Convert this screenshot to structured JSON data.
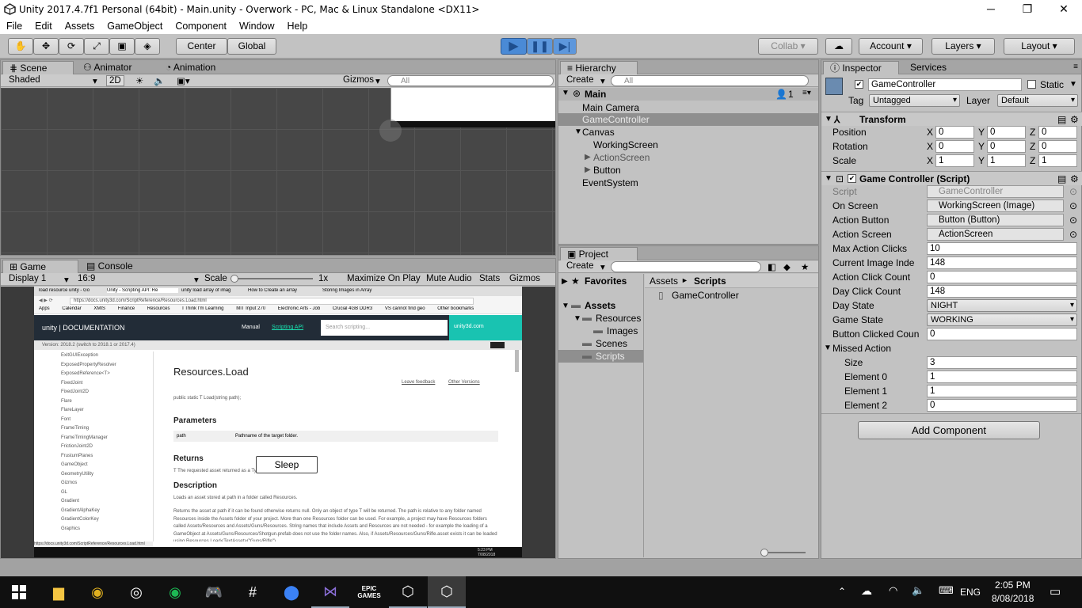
{
  "window": {
    "title": "Unity 2017.4.7f1 Personal (64bit) - Main.unity - Overwork - PC, Mac & Linux Standalone <DX11>"
  },
  "menu": [
    "File",
    "Edit",
    "Assets",
    "GameObject",
    "Component",
    "Window",
    "Help"
  ],
  "toolbar": {
    "center": "Center",
    "global": "Global",
    "collab": "Collab",
    "account": "Account",
    "layers": "Layers",
    "layout": "Layout"
  },
  "scene": {
    "tab_scene": "Scene",
    "tab_animator": "Animator",
    "tab_animation": "Animation",
    "shaded": "Shaded",
    "twod": "2D",
    "gizmos": "Gizmos",
    "search_placeholder": "All"
  },
  "game": {
    "tab_game": "Game",
    "tab_console": "Console",
    "display": "Display 1",
    "aspect": "16:9",
    "scale_label": "Scale",
    "scale_value": "1x",
    "maximize": "Maximize On Play",
    "mute": "Mute Audio",
    "stats": "Stats",
    "gizmos": "Gizmos",
    "sleep_button": "Sleep"
  },
  "browser": {
    "tabs": [
      "load resource unity - Go",
      "Unity - Scripting API: Re",
      "unity load array of imag",
      "How to Create an array",
      "Storing Images in Array"
    ],
    "url": "https://docs.unity3d.com/ScriptReference/Resources.Load.html",
    "bookmarks": [
      "Apps",
      "Calendar",
      "XMIS",
      "Finance",
      "Resources",
      "I Think I'm Learning",
      "MIT Input 270",
      "Electronic Arts - Job",
      "Crucial 4GB DDR3",
      "VS cannot find geo",
      "Other bookmarks"
    ],
    "doc_brand": "unity | DOCUMENTATION",
    "manual": "Manual",
    "scripting_api": "Scripting API",
    "doc_search": "Search scripting...",
    "unity3d": "unity3d.com",
    "version": "Version: 2018.2 (switch to 2018.1 or 2017.4)",
    "left_nav": [
      "ExitGUIException",
      "ExposedPropertyResolver",
      "ExposedReference<T>",
      "FixedJoint",
      "FixedJoint2D",
      "Flare",
      "FlareLayer",
      "Font",
      "FrameTiming",
      "FrameTimingManager",
      "FrictionJoint2D",
      "FrustumPlanes",
      "GameObject",
      "GeometryUtility",
      "Gizmos",
      "GL",
      "Gradient",
      "GradientAlphaKey",
      "GradientColorKey",
      "Graphics"
    ],
    "page_title": "Resources.Load",
    "leave_feedback": "Leave feedback",
    "other_versions": "Other Versions",
    "signature": "public static T Load(string path);",
    "parameters_h": "Parameters",
    "param_name": "path",
    "param_desc": "Pathname of the target folder.",
    "returns_h": "Returns",
    "returns_desc": "T The requested asset returned as a Type.",
    "description_h": "Description",
    "desc1": "Loads an asset stored at path in a folder called Resources.",
    "desc2": "Returns the asset at path if it can be found otherwise returns null. Only an object of type T will be returned. The path is relative to any folder named Resources inside the Assets folder of your project. More than one Resources folder can be used. For example, a project may have Resources folders called Assets/Resources and Assets/Guns/Resources. String names that include Assets and Resources are not needed - for example the loading of a GameObject at Assets/Guns/Resources/Shotgun.prefab does not use the folder names. Also, if Assets/Resources/Guns/Rifle.asset exists it can be loaded using Resources.Load<TextAsset>(\"Guns/Rifle\")",
    "status_url": "https://docs.unity3d.com/ScriptReference/Resources.Load.html",
    "clock": "5:23 PM",
    "date": "7/08/2018"
  },
  "hierarchy": {
    "tab": "Hierarchy",
    "create": "Create",
    "search_placeholder": "All",
    "scene_name": "Main",
    "count": "1",
    "items": [
      "Main Camera",
      "GameController",
      "Canvas",
      "WorkingScreen",
      "ActionScreen",
      "Button",
      "EventSystem"
    ]
  },
  "project": {
    "tab": "Project",
    "create": "Create",
    "favorites": "Favorites",
    "assets": "Assets",
    "folders": [
      "Resources",
      "Images",
      "Scenes",
      "Scripts"
    ],
    "breadcrumb_root": "Assets",
    "breadcrumb_sep": "►",
    "breadcrumb_leaf": "Scripts",
    "files": [
      "GameController"
    ]
  },
  "inspector": {
    "tab_inspector": "Inspector",
    "tab_services": "Services",
    "object_name": "GameController",
    "static": "Static",
    "tag_label": "Tag",
    "tag": "Untagged",
    "layer_label": "Layer",
    "layer": "Default",
    "transform": "Transform",
    "position_label": "Position",
    "rotation_label": "Rotation",
    "scale_label": "Scale",
    "position": [
      "0",
      "0",
      "0"
    ],
    "rotation": [
      "0",
      "0",
      "0"
    ],
    "scale": [
      "1",
      "1",
      "1"
    ],
    "axes": [
      "X",
      "Y",
      "Z"
    ],
    "script_component": "Game Controller (Script)",
    "props": [
      {
        "label": "Script",
        "value": "GameController"
      },
      {
        "label": "On Screen",
        "value": "WorkingScreen (Image)"
      },
      {
        "label": "Action Button",
        "value": "Button (Button)"
      },
      {
        "label": "Action Screen",
        "value": "ActionScreen"
      },
      {
        "label": "Max Action Clicks",
        "value": "10"
      },
      {
        "label": "Current Image Inde",
        "value": "148"
      },
      {
        "label": "Action Click Count",
        "value": "0"
      },
      {
        "label": "Day Click Count",
        "value": "148"
      },
      {
        "label": "Day State",
        "value": "NIGHT"
      },
      {
        "label": "Game State",
        "value": "WORKING"
      },
      {
        "label": "Button Clicked Coun",
        "value": "0"
      }
    ],
    "missed_action": "Missed Action",
    "size_label": "Size",
    "size": "3",
    "elements": [
      {
        "label": "Element 0",
        "value": "1"
      },
      {
        "label": "Element 1",
        "value": "1"
      },
      {
        "label": "Element 2",
        "value": "0"
      }
    ],
    "add_component": "Add Component"
  },
  "taskbar": {
    "lang": "ENG",
    "time": "2:05 PM",
    "date": "8/08/2018",
    "epic": "EPIC GAMES"
  }
}
